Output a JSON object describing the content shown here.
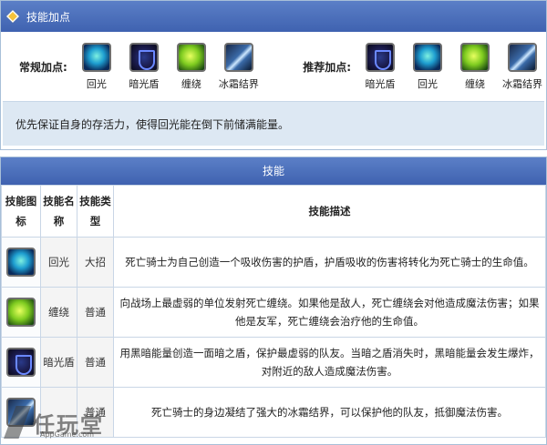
{
  "points_panel": {
    "title": "技能加点",
    "normal_label": "常规加点:",
    "recommended_label": "推荐加点:",
    "normal_skills": [
      {
        "name": "回光",
        "icon": "huiguang"
      },
      {
        "name": "暗光盾",
        "icon": "anguang"
      },
      {
        "name": "缠绕",
        "icon": "chanrao"
      },
      {
        "name": "冰霜结界",
        "icon": "bingshuang"
      }
    ],
    "recommended_skills": [
      {
        "name": "暗光盾",
        "icon": "anguang"
      },
      {
        "name": "回光",
        "icon": "huiguang"
      },
      {
        "name": "缠绕",
        "icon": "chanrao"
      },
      {
        "name": "冰霜结界",
        "icon": "bingshuang"
      }
    ],
    "tip": "优先保证自身的存活力，使得回光能在倒下前储满能量。"
  },
  "skills_table": {
    "title": "技能",
    "headers": {
      "icon": "技能图标",
      "name": "技能名称",
      "type": "技能类型",
      "desc": "技能描述"
    },
    "rows": [
      {
        "icon": "huiguang",
        "name": "回光",
        "type": "大招",
        "desc": "死亡骑士为自己创造一个吸收伤害的护盾，护盾吸收的伤害将转化为死亡骑士的生命值。"
      },
      {
        "icon": "chanrao",
        "name": "缠绕",
        "type": "普通",
        "desc": "向战场上最虚弱的单位发射死亡缠绕。如果他是敌人，死亡缠绕会对他造成魔法伤害；如果他是友军，死亡缠绕会治疗他的生命值。"
      },
      {
        "icon": "anguang",
        "name": "暗光盾",
        "type": "普通",
        "desc": "用黑暗能量创造一面暗之盾，保护最虚弱的队友。当暗之盾消失时，黑暗能量会发生爆炸，对附近的敌人造成魔法伤害。"
      },
      {
        "icon": "bingshuang",
        "name": "",
        "type": "普通",
        "desc": "死亡骑士的身边凝结了强大的冰霜结界，可以保护他的队友，抵御魔法伤害。"
      }
    ]
  },
  "watermark": {
    "text": "任玩堂",
    "sub": "AppGame.com"
  }
}
